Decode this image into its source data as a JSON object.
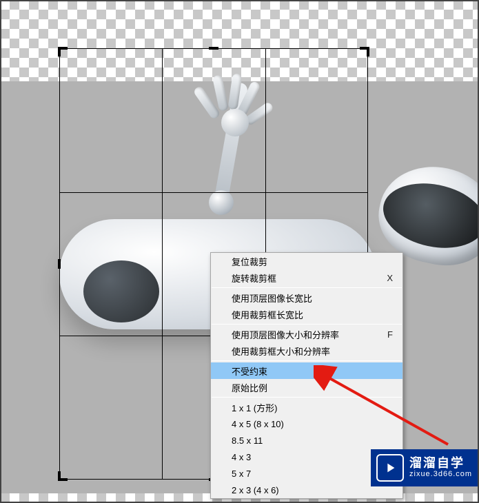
{
  "colors": {
    "highlight": "#90c8f6",
    "menu_bg": "#f0f0f0",
    "menu_border": "#a6a6a6",
    "arrow": "#e31b12",
    "badge_bg": "#00318f"
  },
  "context_menu": {
    "reset_crop": "复位裁剪",
    "rotate_crop": "旋转裁剪框",
    "rotate_crop_shortcut": "X",
    "use_top_layer_ratio": "使用顶层图像长宽比",
    "use_crop_ratio": "使用裁剪框长宽比",
    "use_top_layer_size_res": "使用顶层图像大小和分辨率",
    "use_top_layer_size_res_shortcut": "F",
    "use_crop_size_res": "使用裁剪框大小和分辨率",
    "unconstrained": "不受约束",
    "original_ratio": "原始比例",
    "preset_1x1": "1 x 1  (方形)",
    "preset_4x5": "4 x 5 (8 x 10)",
    "preset_85x11": "8.5 x 11",
    "preset_4x3": "4 x 3",
    "preset_5x7": "5 x 7",
    "preset_2x3": "2 x 3 (4 x 6)"
  },
  "watermark": {
    "title": "溜溜自学",
    "subtitle": "zixue.3d66.com"
  }
}
